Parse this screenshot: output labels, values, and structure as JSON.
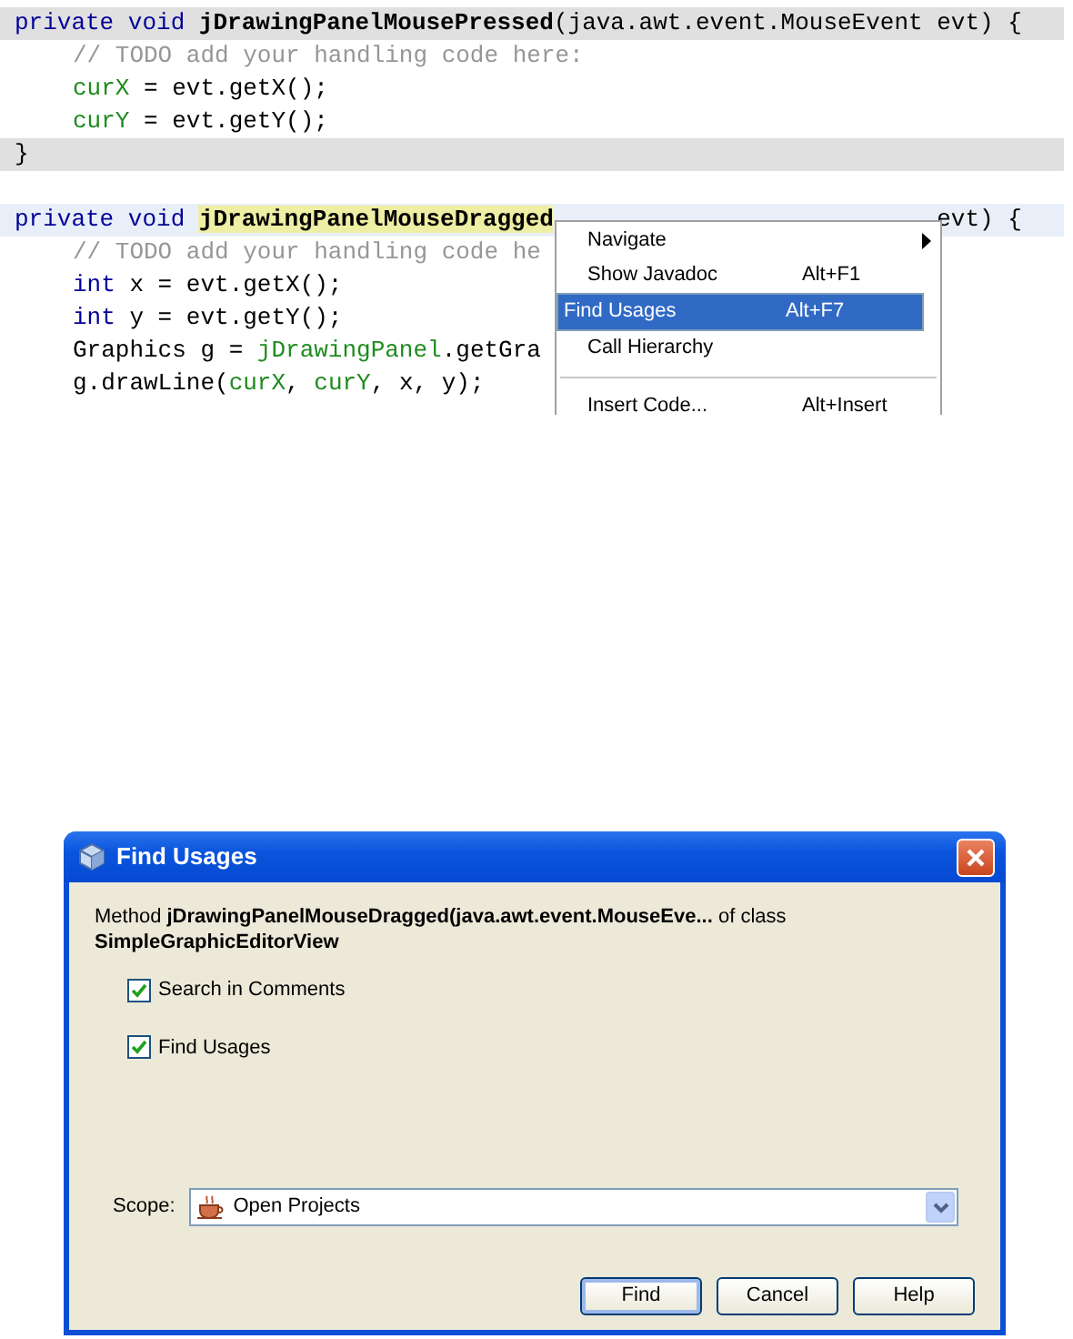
{
  "editor": {
    "blocks": [
      {
        "header": {
          "current": false,
          "tokens": [
            {
              "kind": "keyword",
              "text": "private void "
            },
            {
              "kind": "name",
              "text": "jDrawingPanelMousePressed"
            },
            {
              "kind": "text",
              "text": "(java.awt.event.MouseEvent evt) {"
            }
          ]
        },
        "body": [
          [
            {
              "kind": "comment",
              "text": "// TODO add your handling code here:"
            }
          ],
          [
            {
              "kind": "field",
              "text": "curX"
            },
            {
              "kind": "text",
              "text": " = evt.getX();"
            }
          ],
          [
            {
              "kind": "field",
              "text": "curY"
            },
            {
              "kind": "text",
              "text": " = evt.getY();"
            }
          ]
        ],
        "footer": {
          "current": false,
          "tokens": [
            {
              "kind": "text",
              "text": "}"
            }
          ]
        }
      },
      {
        "header": {
          "current": true,
          "tokens": [
            {
              "kind": "keyword",
              "text": "private void "
            },
            {
              "kind": "name-marked",
              "text": "jDrawingPanelMouseDragged"
            }
          ],
          "tail": "evt) {"
        },
        "body": [
          [
            {
              "kind": "comment",
              "text": "// TODO add your handling code he"
            }
          ],
          [
            {
              "kind": "keyword",
              "text": "int"
            },
            {
              "kind": "text",
              "text": " x = evt.getX();"
            }
          ],
          [
            {
              "kind": "keyword",
              "text": "int"
            },
            {
              "kind": "text",
              "text": " y = evt.getY();"
            }
          ],
          [
            {
              "kind": "text",
              "text": "Graphics g = "
            },
            {
              "kind": "field",
              "text": "jDrawingPanel"
            },
            {
              "kind": "text",
              "text": ".getGra"
            }
          ],
          [
            {
              "kind": "text",
              "text": "g.drawLine("
            },
            {
              "kind": "field",
              "text": "curX"
            },
            {
              "kind": "text",
              "text": ", "
            },
            {
              "kind": "field",
              "text": "curY"
            },
            {
              "kind": "text",
              "text": ", x, y);"
            }
          ]
        ]
      }
    ]
  },
  "context_menu": {
    "items": [
      {
        "kind": "item",
        "label": "Navigate",
        "submenu": true,
        "selected": false
      },
      {
        "kind": "item",
        "label": "Show Javadoc",
        "shortcut": "Alt+F1",
        "selected": false
      },
      {
        "kind": "item",
        "label": "Find Usages",
        "shortcut": "Alt+F7",
        "selected": true
      },
      {
        "kind": "item",
        "label": "Call Hierarchy",
        "selected": false
      },
      {
        "kind": "separator"
      },
      {
        "kind": "item",
        "label": "Insert Code...",
        "shortcut": "Alt+Insert",
        "selected": false
      }
    ]
  },
  "dialog": {
    "title": "Find Usages",
    "message": "Method **jDrawingPanelMouseDragged(java.awt.event.MouseEve...** of class **SimpleGraphicEditorView**",
    "options": [
      {
        "label": "Search in Comments",
        "checked": true
      },
      {
        "label": "Find Usages",
        "checked": true
      }
    ],
    "scope": {
      "label": "Scope:",
      "value": "Open Projects"
    },
    "buttons": [
      {
        "label": "Find",
        "default": true
      },
      {
        "label": "Cancel",
        "default": false
      },
      {
        "label": "Help",
        "default": false
      }
    ]
  }
}
